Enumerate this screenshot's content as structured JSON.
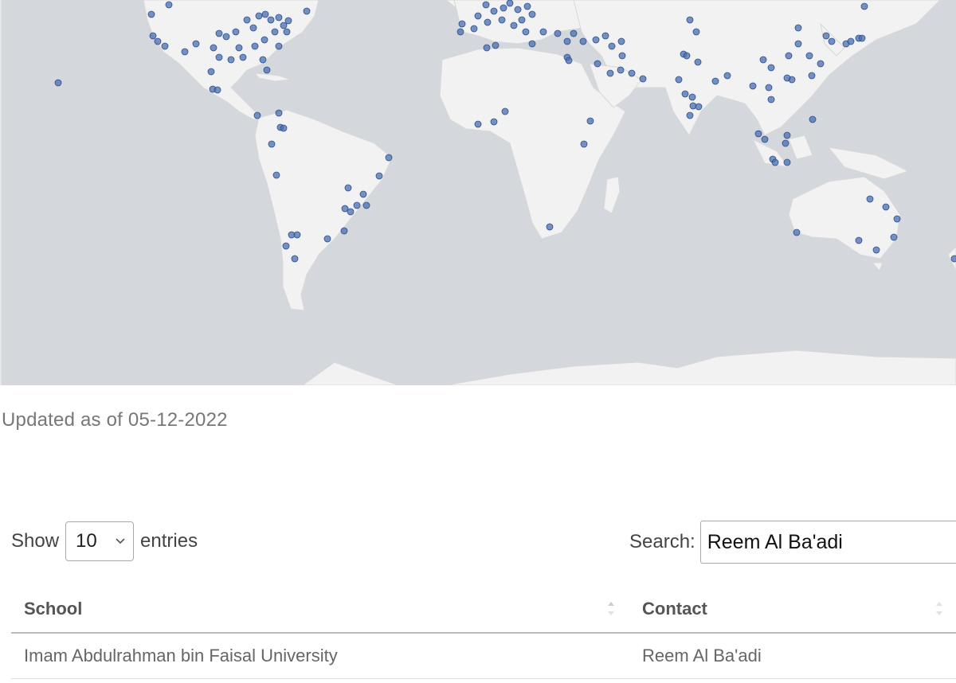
{
  "updated_text": "Updated as of 05-12-2022",
  "length_menu": {
    "show_label": "Show",
    "selected": "10",
    "entries_label": "entries"
  },
  "search": {
    "label": "Search:",
    "value": "Reem Al Ba'adi"
  },
  "table": {
    "columns": [
      "School",
      "Contact"
    ],
    "rows": [
      {
        "school": "Imam Abdulrahman bin Faisal University",
        "contact": "Reem Al Ba'adi"
      }
    ]
  },
  "colors": {
    "ocean": "#d4d7dc",
    "land": "#f2f2f2",
    "marker": "#4a6fb0"
  },
  "icons": {
    "select": "chevron-down-icon",
    "sort": "sort-arrows-icon"
  }
}
